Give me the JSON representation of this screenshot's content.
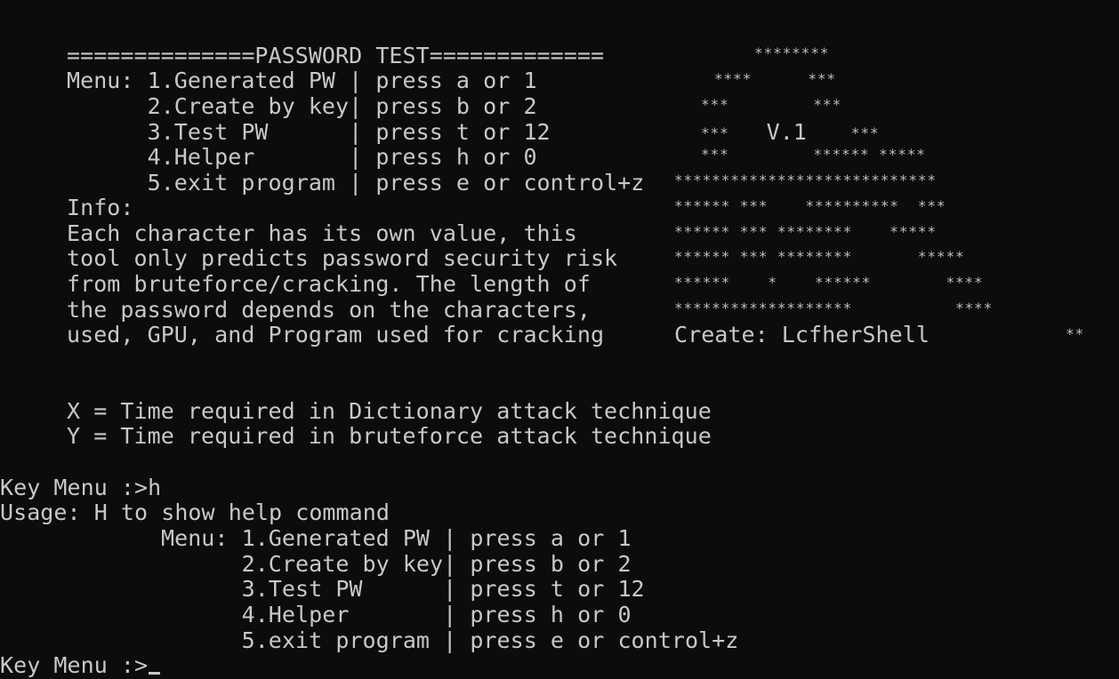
{
  "banner": {
    "title_line": "==============PASSWORD TEST============="
  },
  "menu_block": {
    "lines": [
      "Menu: 1.Generated PW | press a or 1",
      "      2.Create by key| press b or 2",
      "      3.Test PW      | press t or 12",
      "      4.Helper       | press h or 0",
      "      5.exit program | press e or control+z"
    ]
  },
  "info_block": {
    "label": "Info:",
    "lines": [
      "Each character has its own value, this",
      "tool only predicts password security risk",
      "from bruteforce/cracking. The length of",
      "the password depends on the characters,",
      "used, GPU, and Program used for cracking"
    ]
  },
  "ascii_art": {
    "lines": [
      "********",
      "****      ***",
      "***         ***",
      "***    V.1    ***",
      "***         ****** *****",
      "****************************",
      "****** ***    **********  ***",
      "****** *** ********    *****",
      "****** *** ********       *****",
      "******    *    ******        ****",
      "*******************           ****",
      "Create: LcfherShell              **"
    ],
    "version": "V.1",
    "creator": "Create: LcfherShell"
  },
  "legend": {
    "x_line": "X = Time required in Dictionary attack technique",
    "y_line": "Y = Time required in bruteforce attack technique"
  },
  "session": {
    "prompt_1": "Key Menu :>h",
    "usage": "Usage: H to show help command",
    "help_lines": [
      "Menu: 1.Generated PW | press a or 1",
      "      2.Create by key| press b or 2",
      "      3.Test PW      | press t or 12",
      "      4.Helper       | press h or 0",
      "      5.exit program | press e or control+z"
    ],
    "prompt_2": "Key Menu :>"
  },
  "colors": {
    "background": "#0c0c0c",
    "foreground": "#c8c8c8"
  }
}
